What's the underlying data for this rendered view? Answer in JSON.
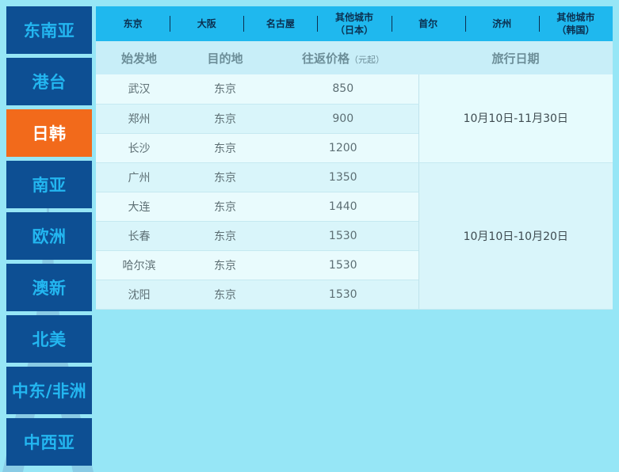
{
  "sidebar": {
    "items": [
      {
        "label": "东南亚"
      },
      {
        "label": "港台"
      },
      {
        "label": "日韩",
        "active": true
      },
      {
        "label": "南亚"
      },
      {
        "label": "欧洲"
      },
      {
        "label": "澳新"
      },
      {
        "label": "北美"
      },
      {
        "label": "中东/非洲"
      },
      {
        "label": "中西亚"
      }
    ]
  },
  "tabs": [
    {
      "line1": "东京",
      "line2": ""
    },
    {
      "line1": "大阪",
      "line2": ""
    },
    {
      "line1": "名古屋",
      "line2": ""
    },
    {
      "line1": "其他城市",
      "line2": "（日本）"
    },
    {
      "line1": "首尔",
      "line2": ""
    },
    {
      "line1": "济州",
      "line2": ""
    },
    {
      "line1": "其他城市",
      "line2": "（韩国）"
    }
  ],
  "table": {
    "headers": {
      "origin": "始发地",
      "destination": "目的地",
      "price": "往返价格",
      "price_note": "（元起）",
      "dates": "旅行日期"
    },
    "rows": [
      {
        "origin": "武汉",
        "destination": "东京",
        "price": "850"
      },
      {
        "origin": "郑州",
        "destination": "东京",
        "price": "900"
      },
      {
        "origin": "长沙",
        "destination": "东京",
        "price": "1200"
      },
      {
        "origin": "广州",
        "destination": "东京",
        "price": "1350"
      },
      {
        "origin": "大连",
        "destination": "东京",
        "price": "1440"
      },
      {
        "origin": "长春",
        "destination": "东京",
        "price": "1530"
      },
      {
        "origin": "哈尔滨",
        "destination": "东京",
        "price": "1530"
      },
      {
        "origin": "沈阳",
        "destination": "东京",
        "price": "1530"
      }
    ],
    "date_groups": [
      {
        "label": "10月10日-11月30日"
      },
      {
        "label": "10月10日-10月20日"
      }
    ]
  },
  "colors": {
    "background": "#96e6f6",
    "sidebar_bg": "#0d4f93",
    "sidebar_text": "#23b6f0",
    "active_bg": "#f26a1b",
    "tab_bar": "#1fb8ee"
  },
  "icons": {
    "decoration": "eiffel-tower-icon"
  }
}
